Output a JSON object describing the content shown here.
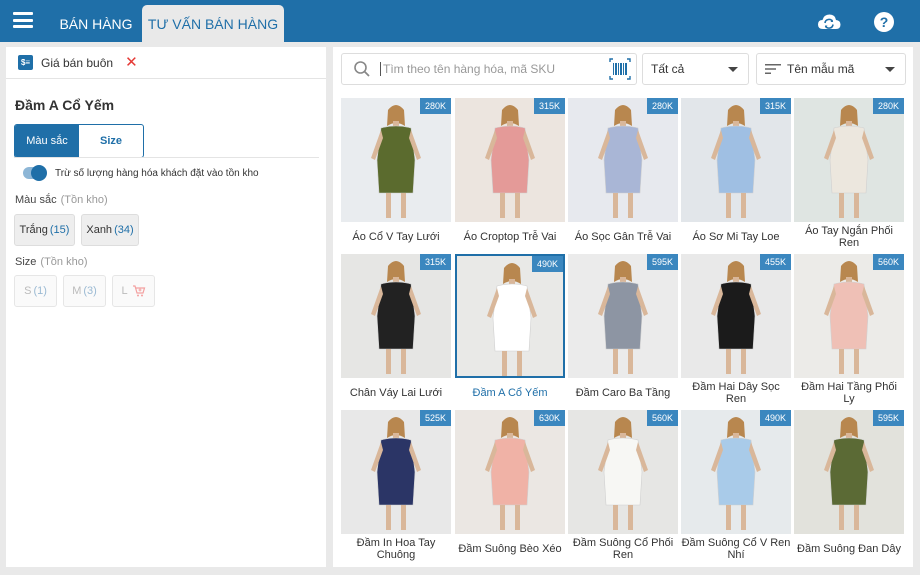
{
  "header": {
    "tabs": [
      {
        "label": "BÁN HÀNG",
        "active": false
      },
      {
        "label": "TƯ VẤN BÁN HÀNG",
        "active": true
      }
    ],
    "icons": [
      "menu-icon",
      "cloud-sync-icon",
      "help-icon"
    ],
    "accent_color": "#1f6fa8"
  },
  "left": {
    "price_list_label": "Giá bán buôn",
    "product_name": "Đầm A Cổ Yếm",
    "segments": [
      "Màu sắc",
      "Size"
    ],
    "toggle_label": "Trừ số lượng hàng hóa khách đặt vào tồn kho",
    "toggle_on": true,
    "color_section": {
      "label": "Màu sắc",
      "sub": "(Tồn kho)"
    },
    "colors": [
      {
        "name": "Trắng",
        "count": "(15)"
      },
      {
        "name": "Xanh",
        "count": "(34)"
      }
    ],
    "size_section": {
      "label": "Size",
      "sub": "(Tồn kho)"
    },
    "sizes": [
      {
        "name": "S",
        "count": "(1)"
      },
      {
        "name": "M",
        "count": "(3)"
      },
      {
        "name": "L",
        "count": ""
      }
    ]
  },
  "right": {
    "search_placeholder": "Tìm theo tên hàng hóa, mã SKU",
    "filter_all": "Tất cả",
    "sort_label": "Tên mẫu mã",
    "products": [
      {
        "name": "Áo Cổ V Tay Lưới",
        "price": "280K",
        "bg": "#e9ecef",
        "color": "#5b6b2e"
      },
      {
        "name": "Áo Croptop Trễ Vai",
        "price": "315K",
        "bg": "#ece5df",
        "color": "#e49a98"
      },
      {
        "name": "Áo Sọc Gân Trễ Vai",
        "price": "280K",
        "bg": "#e7e9ee",
        "color": "#a9b6d6"
      },
      {
        "name": "Áo Sơ Mi Tay Loe",
        "price": "315K",
        "bg": "#e2e6ea",
        "color": "#9fbfe3"
      },
      {
        "name": "Áo Tay Ngắn Phối Ren",
        "price": "280K",
        "bg": "#dfe5e2",
        "color": "#ece7de"
      },
      {
        "name": "Chân Váy Lai Lưới",
        "price": "315K",
        "bg": "#e6e6e4",
        "color": "#222222"
      },
      {
        "name": "Đầm A Cổ Yếm",
        "price": "490K",
        "bg": "#e9e9e7",
        "color": "#ffffff",
        "selected": true
      },
      {
        "name": "Đầm Caro Ba Tầng",
        "price": "595K",
        "bg": "#ebebeb",
        "color": "#8d95a3"
      },
      {
        "name": "Đầm Hai Dây Sọc Ren",
        "price": "455K",
        "bg": "#e9e9e9",
        "color": "#1b1b1b"
      },
      {
        "name": "Đầm Hai Tầng Phối Ly",
        "price": "560K",
        "bg": "#ecebe8",
        "color": "#efc0b6"
      },
      {
        "name": "Đầm In Hoa Tay Chuông",
        "price": "525K",
        "bg": "#e8e8e8",
        "color": "#2b3566"
      },
      {
        "name": "Đầm Suông Bèo Xéo",
        "price": "630K",
        "bg": "#ebe7e3",
        "color": "#f0b2a6"
      },
      {
        "name": "Đầm Suông Cổ Phối Ren",
        "price": "560K",
        "bg": "#e6e6e4",
        "color": "#f7f7f4"
      },
      {
        "name": "Đầm Suông Cổ V Ren Nhí",
        "price": "490K",
        "bg": "#e6eaec",
        "color": "#a9cbe9"
      },
      {
        "name": "Đầm Suông Đan Dây",
        "price": "595K",
        "bg": "#e2e2dc",
        "color": "#5b6a35"
      }
    ]
  }
}
